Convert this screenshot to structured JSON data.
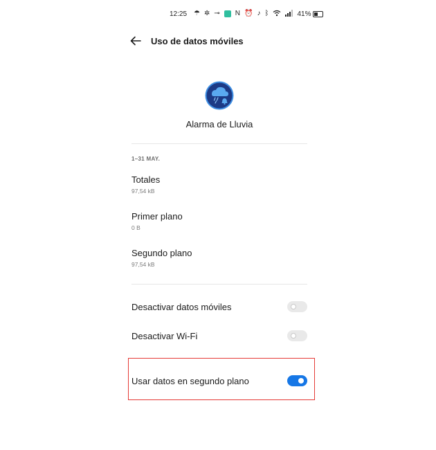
{
  "status_bar": {
    "time": "12:25",
    "battery_text": "41%",
    "battery_level": 0.41,
    "icons": [
      "weather-icon",
      "fan-icon",
      "key-icon",
      "app-notification-icon",
      "nfc-icon",
      "alarm-icon",
      "mute-icon",
      "bluetooth-icon",
      "wifi-icon",
      "signal-icon",
      "battery-icon"
    ]
  },
  "header": {
    "title": "Uso de datos móviles",
    "back_icon": "arrow-left-icon"
  },
  "app": {
    "name": "Alarma de Lluvia",
    "icon": "rain-cloud-bell-icon",
    "icon_colors": {
      "background": "#1c3a86",
      "ring": "#3f8fe3",
      "cloud": "#5aa9f0"
    }
  },
  "usage": {
    "period": "1–31 MAY.",
    "rows": [
      {
        "label": "Totales",
        "value": "97,54 kB"
      },
      {
        "label": "Primer plano",
        "value": "0 B"
      },
      {
        "label": "Segundo plano",
        "value": "97,54 kB"
      }
    ]
  },
  "toggles": [
    {
      "label": "Desactivar datos móviles",
      "on": false
    },
    {
      "label": "Desactivar Wi-Fi",
      "on": false
    },
    {
      "label": "Usar datos en segundo plano",
      "on": true
    }
  ],
  "colors": {
    "accent": "#1677e6",
    "highlight_border": "#e53935",
    "toggle_off": "#e9e9e9"
  }
}
